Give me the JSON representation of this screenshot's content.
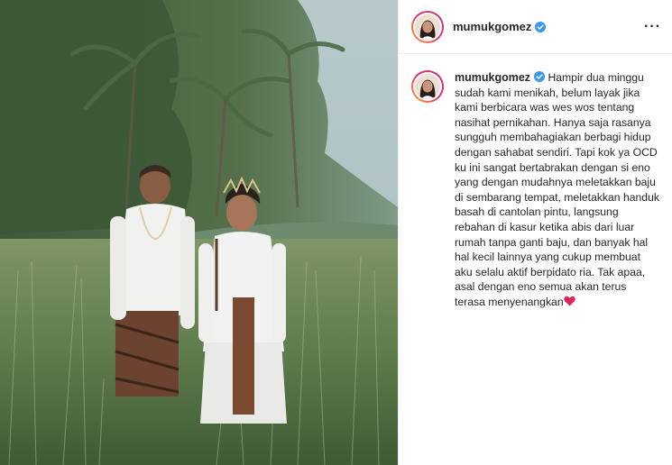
{
  "header": {
    "username": "mumukgomez",
    "verified_icon": "verified-badge-icon",
    "more_icon": "more-options-icon"
  },
  "caption": {
    "username": "mumukgomez",
    "text": "Hampir dua minggu sudah kami menikah, belum layak jika kami berbicara was wes wos tentang nasihat pernikahan. Hanya saja rasanya sungguh membahagiakan berbagi hidup dengan sahabat sendiri. Tapi kok ya OCD ku ini sangat bertabrakan dengan si eno yang dengan mudahnya meletakkan baju di sembarang tempat, meletakkan handuk basah di cantolan pintu, langsung rebahan di kasur ketika abis dari luar rumah tanpa ganti baju, dan banyak hal hal kecil lainnya yang cukup membuat aku selalu aktif berpidato ria. Tak apaa, asal dengan eno semua akan terus terasa menyenangkan",
    "emoji": "red-heart-icon"
  },
  "colors": {
    "verified": "#3897f0",
    "heart": "#e0245e",
    "avatar_ring_start": "#f9a33a",
    "avatar_ring_end": "#c13584"
  }
}
